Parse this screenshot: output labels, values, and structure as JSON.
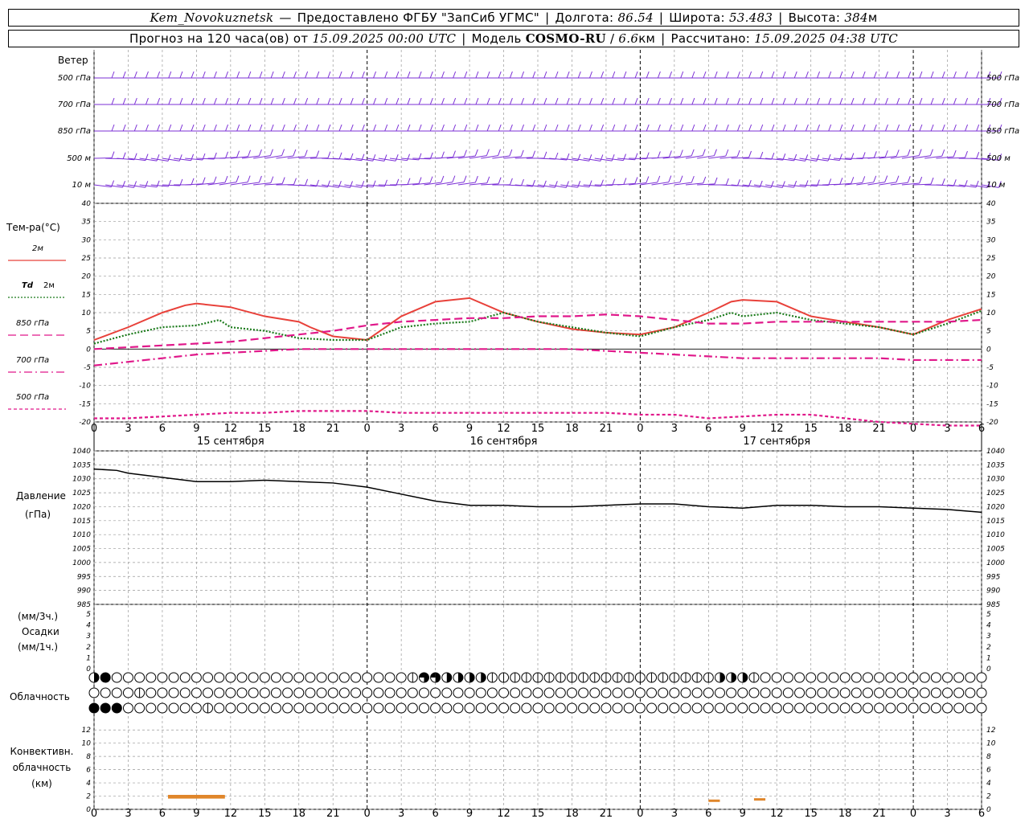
{
  "header": {
    "station": "Kem_Novokuznetsk",
    "dash": "—",
    "provider": "Предоставлено ФГБУ \"ЗапСиб УГМС\"",
    "lon_label": "Долгота:",
    "lon_value": "86.54",
    "lat_label": "Широта:",
    "lat_value": "53.483",
    "alt_label": "Высота:",
    "alt_value": "384",
    "alt_unit": "м",
    "forecast_label": "Прогноз на 120 часа(ов) от",
    "forecast_start": "15.09.2025 00:00 UTC",
    "model_label": "Модель",
    "model_name": "COSMO-RU",
    "model_res": "6.6",
    "model_res_unit": "км",
    "calc_label": "Рассчитано:",
    "calc_time": "15.09.2025 04:38 UTC"
  },
  "time_axis": {
    "hour_labels": [
      "0",
      "3",
      "6",
      "9",
      "12",
      "15",
      "18",
      "21",
      "0",
      "3",
      "6",
      "9",
      "12",
      "15",
      "18",
      "21",
      "0",
      "3",
      "6",
      "9",
      "12",
      "15",
      "18",
      "21",
      "0",
      "3",
      "6"
    ],
    "day_labels": [
      "15 сентября",
      "16 сентября",
      "17 сентября"
    ]
  },
  "wind_panel": {
    "title": "Ветер",
    "levels": [
      "500 гПа",
      "700 гПа",
      "850 гПа",
      "500 м",
      "10 м"
    ],
    "color": "#7b2fd6"
  },
  "temperature_panel": {
    "title": "Тем-ра(°C)",
    "legend": [
      {
        "label": "2м",
        "color": "#e8413a",
        "style": "solid"
      },
      {
        "label_italic": "Td",
        "label": "2м",
        "color": "#1a7a1a",
        "style": "dotted"
      },
      {
        "label": "850 гПа",
        "color": "#e0188a",
        "style": "dashed"
      },
      {
        "label": "700 гПа",
        "color": "#e0188a",
        "style": "dashdot"
      },
      {
        "label": "500 гПа",
        "color": "#e0188a",
        "style": "dotted"
      }
    ]
  },
  "pressure_panel": {
    "title": "Давление",
    "unit": "(гПа)"
  },
  "precip_panel": {
    "unit3h": "(мм/3ч.)",
    "title": "Осадки",
    "unit1h": "(мм/1ч.)"
  },
  "cloud_panel": {
    "title": "Облачность"
  },
  "convective_panel": {
    "title_lines": [
      "Конвективн.",
      "облачность",
      "(км)"
    ],
    "color": "#e0862a"
  },
  "chart_data": [
    {
      "type": "line",
      "title": "Тем-ра(°C)",
      "x_unit": "hours since 15.09.2025 00:00 UTC",
      "ylim": [
        -20,
        40
      ],
      "y_ticks": [
        -20,
        -15,
        -10,
        -5,
        0,
        5,
        10,
        15,
        20,
        25,
        30,
        35,
        40
      ],
      "series": [
        {
          "name": "2м",
          "color": "#e8413a",
          "x": [
            0,
            3,
            6,
            8,
            9,
            12,
            15,
            18,
            19,
            21,
            24,
            27,
            30,
            33,
            36,
            39,
            42,
            45,
            48,
            51,
            54,
            56,
            57,
            60,
            63,
            66,
            69,
            72,
            75,
            78
          ],
          "y": [
            2.5,
            6,
            10,
            12,
            12.5,
            11.5,
            9,
            7.5,
            6,
            3.5,
            2.5,
            9,
            13,
            14,
            10,
            7.5,
            5.5,
            4.5,
            4,
            6,
            10,
            13,
            13.5,
            13,
            9,
            7.5,
            6,
            4,
            8,
            11
          ]
        },
        {
          "name": "Td 2м",
          "color": "#1a7a1a",
          "x": [
            0,
            3,
            6,
            9,
            11,
            12,
            15,
            18,
            21,
            24,
            27,
            30,
            33,
            36,
            39,
            42,
            45,
            48,
            51,
            54,
            56,
            57,
            60,
            63,
            66,
            69,
            72,
            75,
            78
          ],
          "y": [
            1.5,
            4,
            6,
            6.5,
            8,
            6,
            5,
            3,
            2.5,
            2.5,
            6,
            7,
            7.5,
            10,
            7.5,
            6,
            4.5,
            3.5,
            6,
            8,
            10,
            9,
            10,
            8,
            7,
            6,
            4,
            7,
            10.5
          ]
        },
        {
          "name": "850 гПа",
          "color": "#e0188a",
          "x": [
            0,
            3,
            6,
            9,
            12,
            15,
            18,
            21,
            24,
            27,
            30,
            33,
            36,
            39,
            42,
            45,
            48,
            51,
            54,
            57,
            60,
            63,
            66,
            69,
            72,
            75,
            78
          ],
          "y": [
            0,
            0.5,
            1,
            1.5,
            2,
            3,
            4,
            5,
            6.5,
            7.5,
            8,
            8.5,
            8.5,
            9,
            9,
            9.5,
            9,
            8,
            7,
            7,
            7.5,
            7.5,
            7.5,
            7.5,
            7.5,
            7.5,
            8
          ]
        },
        {
          "name": "700 гПа",
          "color": "#e0188a",
          "x": [
            0,
            3,
            6,
            9,
            12,
            15,
            18,
            21,
            24,
            27,
            30,
            33,
            36,
            39,
            42,
            45,
            48,
            51,
            54,
            57,
            60,
            63,
            66,
            69,
            72,
            75,
            78
          ],
          "y": [
            -4.5,
            -3.5,
            -2.5,
            -1.5,
            -1,
            -0.5,
            0,
            0,
            0,
            0,
            0,
            0,
            0,
            0,
            0,
            -0.5,
            -1,
            -1.5,
            -2,
            -2.5,
            -2.5,
            -2.5,
            -2.5,
            -2.5,
            -3,
            -3,
            -3
          ]
        },
        {
          "name": "500 гПа",
          "color": "#e0188a",
          "x": [
            0,
            3,
            6,
            9,
            12,
            15,
            18,
            21,
            24,
            27,
            30,
            33,
            36,
            39,
            42,
            45,
            48,
            51,
            54,
            57,
            60,
            63,
            66,
            69,
            72,
            75,
            78
          ],
          "y": [
            -19,
            -19,
            -18.5,
            -18,
            -17.5,
            -17.5,
            -17,
            -17,
            -17,
            -17.5,
            -17.5,
            -17.5,
            -17.5,
            -17.5,
            -17.5,
            -17.5,
            -18,
            -18,
            -19,
            -18.5,
            -18,
            -18,
            -19,
            -20,
            -20.5,
            -21,
            -21
          ]
        }
      ]
    },
    {
      "type": "line",
      "title": "Давление",
      "ylabel": "(гПа)",
      "ylim": [
        985,
        1040
      ],
      "y_ticks": [
        985,
        990,
        995,
        1000,
        1005,
        1010,
        1015,
        1020,
        1025,
        1030,
        1035,
        1040
      ],
      "series": [
        {
          "name": "Давление",
          "color": "#000000",
          "x": [
            0,
            2,
            3,
            6,
            9,
            12,
            15,
            18,
            21,
            24,
            27,
            30,
            33,
            36,
            39,
            42,
            45,
            48,
            51,
            54,
            57,
            60,
            63,
            66,
            69,
            72,
            75,
            78
          ],
          "y": [
            1033.5,
            1033,
            1032,
            1030.5,
            1029,
            1029,
            1029.5,
            1029,
            1028.5,
            1027,
            1024.5,
            1022,
            1020.5,
            1020.5,
            1020,
            1020,
            1020.5,
            1021,
            1021,
            1020,
            1019.5,
            1020.5,
            1020.5,
            1020,
            1020,
            1019.5,
            1019,
            1018
          ]
        }
      ]
    },
    {
      "type": "bar",
      "title": "Осадки",
      "ylim": [
        0,
        5
      ],
      "y_ticks": [
        0,
        1,
        2,
        3,
        4,
        5
      ],
      "series": []
    },
    {
      "type": "bar",
      "title": "Конвективн. облачность (км)",
      "ylim": [
        0,
        13
      ],
      "y_ticks": [
        0,
        2,
        4,
        6,
        8,
        10,
        12
      ],
      "series": [
        {
          "name": "Конвективн. облачность",
          "color": "#e0862a",
          "segments": [
            {
              "x0": 6.5,
              "x1": 11.5,
              "y": 2
            },
            {
              "x0": 6.5,
              "x1": 11.5,
              "y": 1.8
            },
            {
              "x0": 54,
              "x1": 55,
              "y": 1.3
            },
            {
              "x0": 58,
              "x1": 59,
              "y": 1.5
            }
          ]
        }
      ]
    }
  ],
  "wind_data": {
    "rows": [
      {
        "level": "500 гПа",
        "dir": [
          270,
          270,
          270,
          270,
          270,
          270,
          275,
          275,
          280,
          285,
          290,
          290,
          290,
          280,
          275,
          270,
          270,
          270,
          270,
          270,
          270,
          270,
          270,
          270,
          270,
          270,
          270,
          270,
          270,
          270,
          270,
          270,
          270,
          270,
          270,
          270,
          270,
          270,
          270,
          270,
          270,
          270,
          270,
          270,
          270,
          270,
          270,
          270,
          270,
          270,
          270,
          270,
          270,
          270,
          270,
          270,
          270,
          270,
          270,
          270,
          270,
          270,
          270,
          270,
          270,
          270,
          270,
          270,
          270,
          270,
          270,
          270,
          270,
          270,
          270,
          270,
          270,
          270,
          270
        ],
        "speed": [
          25,
          25,
          25,
          25,
          25,
          25,
          25,
          25,
          25,
          25,
          20,
          20,
          20,
          15,
          15,
          15,
          15,
          15,
          15,
          15,
          15,
          15,
          15,
          15,
          15,
          15,
          15,
          15,
          15,
          15,
          15,
          15,
          15,
          15,
          15,
          15,
          15,
          15,
          15,
          15,
          15,
          15,
          15,
          15,
          15,
          15,
          15,
          15,
          15,
          15,
          15,
          15,
          15,
          15,
          15,
          15,
          15,
          15,
          15,
          15,
          15,
          15,
          15,
          15,
          15,
          15,
          15,
          15,
          15,
          15,
          15,
          15,
          15,
          15,
          15,
          15,
          15,
          15,
          15
        ]
      }
    ]
  },
  "cloud_data": {
    "rows": 3,
    "count": 79,
    "top": [
      2,
      4,
      0,
      0,
      0,
      0,
      0,
      0,
      0,
      0,
      0,
      0,
      0,
      0,
      0,
      0,
      0,
      0,
      0,
      0,
      0,
      0,
      0,
      0,
      0,
      0,
      0,
      0,
      1,
      3,
      3,
      2,
      2,
      2,
      2,
      1,
      1,
      1,
      1,
      1,
      1,
      1,
      1,
      1,
      1,
      1,
      1,
      1,
      1,
      1,
      1,
      1,
      1,
      1,
      1,
      2,
      2,
      2,
      1,
      0,
      0,
      0,
      0,
      0,
      0,
      0,
      0,
      0,
      0,
      0,
      0,
      0,
      0,
      0,
      0,
      0,
      0,
      0,
      0
    ],
    "mid": [
      0,
      0,
      0,
      0,
      1,
      0,
      0,
      0,
      0,
      0,
      0,
      0,
      0,
      0,
      0,
      0,
      0,
      0,
      0,
      0,
      0,
      0,
      0,
      0,
      0,
      0,
      0,
      0,
      0,
      0,
      0,
      0,
      0,
      0,
      0,
      0,
      0,
      0,
      0,
      0,
      0,
      0,
      0,
      0,
      0,
      0,
      0,
      0,
      0,
      0,
      0,
      0,
      0,
      0,
      0,
      0,
      0,
      0,
      0,
      0,
      0,
      0,
      0,
      0,
      0,
      0,
      0,
      0,
      0,
      0,
      0,
      0,
      0,
      0,
      0,
      0,
      0,
      0,
      0
    ],
    "low": [
      4,
      4,
      4,
      0,
      0,
      0,
      0,
      0,
      0,
      0,
      1,
      0,
      0,
      0,
      0,
      0,
      0,
      0,
      0,
      0,
      0,
      0,
      0,
      0,
      0,
      0,
      0,
      0,
      0,
      0,
      0,
      0,
      0,
      0,
      0,
      0,
      0,
      0,
      0,
      0,
      0,
      0,
      0,
      0,
      0,
      0,
      0,
      0,
      0,
      0,
      0,
      0,
      0,
      0,
      0,
      0,
      0,
      0,
      0,
      0,
      0,
      0,
      0,
      0,
      0,
      0,
      0,
      0,
      0,
      0,
      0,
      0,
      0,
      0,
      0,
      0,
      0,
      0,
      0
    ]
  }
}
